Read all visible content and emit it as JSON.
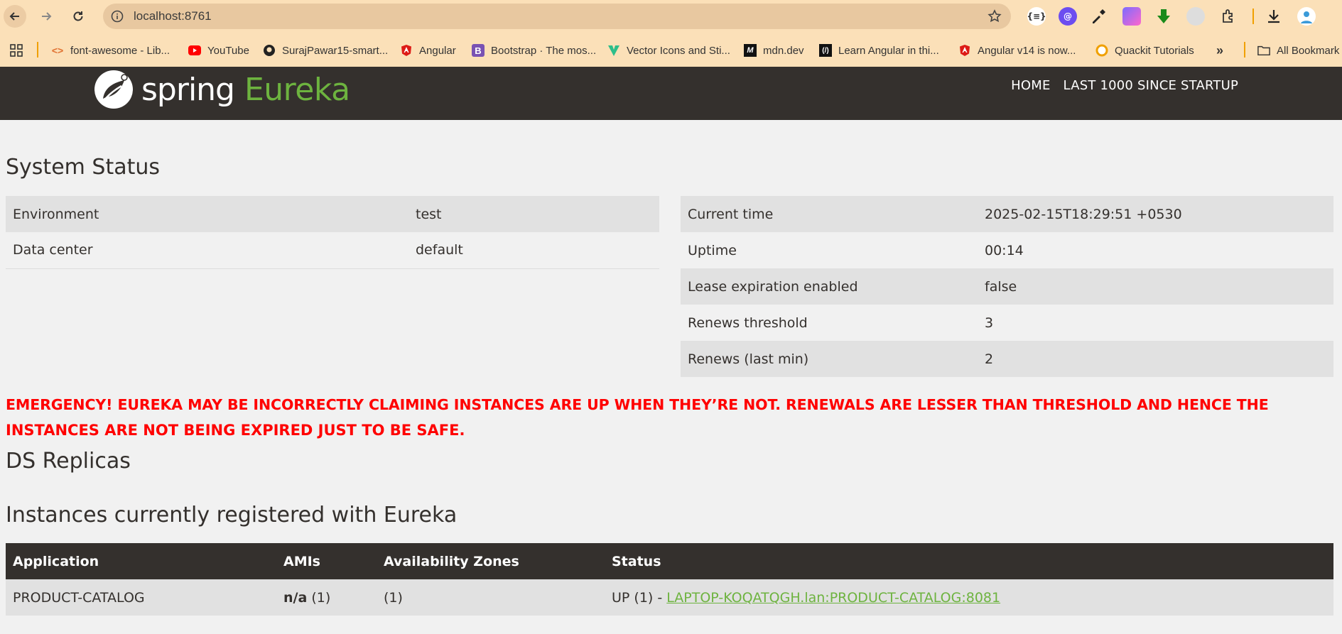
{
  "browser": {
    "url": "localhost:8761",
    "bookmarks": [
      {
        "label": "font-awesome - Lib...",
        "icon": "code-icon",
        "color": "#e07030"
      },
      {
        "label": "YouTube",
        "icon": "youtube-icon",
        "color": "#ff0000"
      },
      {
        "label": "SurajPawar15-smart...",
        "icon": "github-icon",
        "color": "#222222"
      },
      {
        "label": "Angular",
        "icon": "angular-icon",
        "color": "#dd1b16"
      },
      {
        "label": "Bootstrap · The mos...",
        "icon": "bootstrap-icon",
        "color": "#7952b3"
      },
      {
        "label": "Vector Icons and Sti...",
        "icon": "vector-icon",
        "color": "#2dbe8a"
      },
      {
        "label": "mdn.dev",
        "icon": "mdn-icon",
        "color": "#111111"
      },
      {
        "label": "Learn Angular in thi...",
        "icon": "angular-learn-icon",
        "color": "#111111"
      },
      {
        "label": "Angular v14 is now...",
        "icon": "angular-icon",
        "color": "#dd1b16"
      },
      {
        "label": "Quackit Tutorials",
        "icon": "quackit-icon",
        "color": "#f0a000"
      }
    ],
    "all_bookmarks_label": "All Bookmark"
  },
  "header": {
    "logo_word_1": "spring",
    "logo_word_2": "Eureka",
    "nav": [
      "HOME",
      "LAST 1000 SINCE STARTUP"
    ]
  },
  "system_status": {
    "title": "System Status",
    "left": [
      {
        "label": "Environment",
        "value": "test"
      },
      {
        "label": "Data center",
        "value": "default"
      }
    ],
    "right": [
      {
        "label": "Current time",
        "value": "2025-02-15T18:29:51 +0530"
      },
      {
        "label": "Uptime",
        "value": "00:14"
      },
      {
        "label": "Lease expiration enabled",
        "value": "false"
      },
      {
        "label": "Renews threshold",
        "value": "3"
      },
      {
        "label": "Renews (last min)",
        "value": "2"
      }
    ]
  },
  "emergency": {
    "line1": "EMERGENCY! EUREKA MAY BE INCORRECTLY CLAIMING INSTANCES ARE UP WHEN THEY’RE NOT. RENEWALS ARE LESSER THAN THRESHOLD AND HENCE THE",
    "line2": "INSTANCES ARE NOT BEING EXPIRED JUST TO BE SAFE."
  },
  "ds_replicas": {
    "title": "DS Replicas"
  },
  "instances": {
    "title": "Instances currently registered with Eureka",
    "columns": [
      "Application",
      "AMIs",
      "Availability Zones",
      "Status"
    ],
    "rows": [
      {
        "application": "PRODUCT-CATALOG",
        "amis_bold": "n/a",
        "amis_count": "(1)",
        "zones": "(1)",
        "status_prefix": "UP (1) - ",
        "status_link": "LAPTOP-KOQATQGH.lan:PRODUCT-CATALOG:8081"
      }
    ]
  },
  "colors": {
    "brand_green": "#6db33f",
    "header_dark": "#34302d",
    "chrome_bg": "#fbe0b8",
    "emergency_red": "#ff0000"
  }
}
